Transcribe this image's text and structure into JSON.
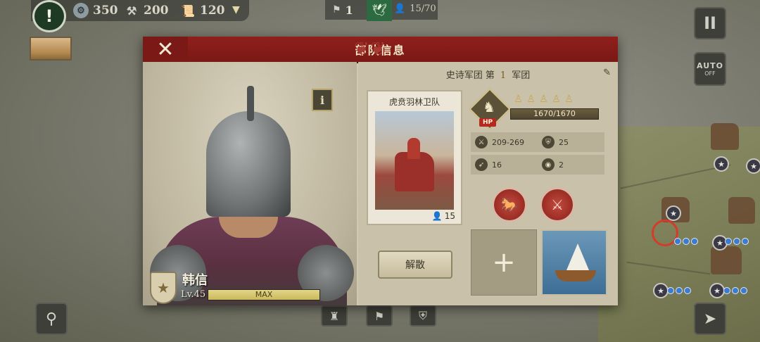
{
  "hud": {
    "alert": "!",
    "resources": [
      {
        "icon": "silver-coin-icon",
        "value": "350"
      },
      {
        "icon": "anvil-icon",
        "value": "200"
      },
      {
        "icon": "scroll-icon",
        "value": "120"
      }
    ],
    "expand_icon": "chevron-down-icon",
    "center": {
      "tribute": "1",
      "population": "15/70"
    }
  },
  "controls": {
    "pause": "II",
    "auto_top": "AUTO",
    "auto_bottom": "OFF"
  },
  "dialog": {
    "title": "部队信息",
    "close_label": "✕",
    "army_prefix": "史诗军团 第",
    "army_number": "1",
    "army_suffix": "军团",
    "general": {
      "name": "韩信",
      "level": "Lv.45",
      "xp_label": "MAX",
      "xp_fraction": 1.0
    },
    "unit": {
      "name": "虎贲羽林卫队",
      "count": "15",
      "hp_tag": "HP",
      "hp_text": "1670/1670",
      "hp_fraction": 1.0,
      "stars": 5,
      "stats": [
        {
          "icon": "attack-icon",
          "value": "209-269"
        },
        {
          "icon": "defense-icon",
          "value": "25"
        },
        {
          "icon": "speed-icon",
          "value": "16"
        },
        {
          "icon": "vision-icon",
          "value": "2"
        }
      ]
    },
    "disband_label": "解散",
    "add_label": "+"
  },
  "colors": {
    "header_red": "#8f1f1b",
    "panel_bg": "#cfc8b2",
    "gold": "#c9a64a"
  }
}
